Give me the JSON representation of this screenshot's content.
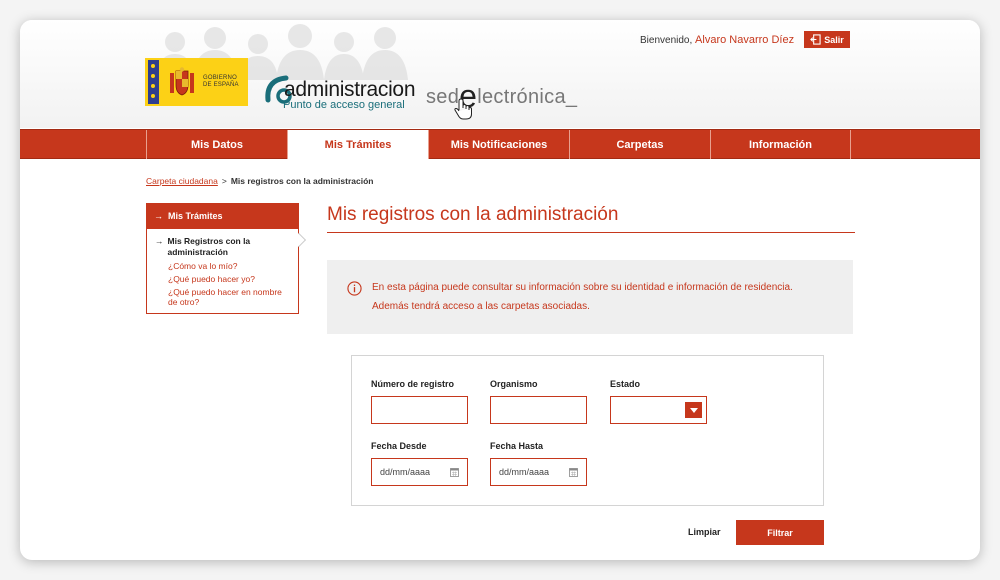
{
  "header": {
    "welcome_prefix": "Bienvenido,",
    "user_name": "Alvaro Navarro Díez",
    "logout_label": "Salir",
    "gobierno_text_1": "GOBIERNO",
    "gobierno_text_2": "DE ESPAÑA",
    "admin_logo_word": "administracion",
    "admin_logo_sub": "Punto de acceso general",
    "sede_logo_prefix": "sed",
    "sede_logo_e": "e",
    "sede_logo_suffix": "lectrónica_"
  },
  "nav": {
    "items": [
      {
        "label": "Mis Datos"
      },
      {
        "label": "Mis Trámites"
      },
      {
        "label": "Mis Notificaciones"
      },
      {
        "label": "Carpetas"
      },
      {
        "label": "Información"
      }
    ],
    "active_index": 1
  },
  "breadcrumb": {
    "link": "Carpeta ciudadana",
    "separator": ">",
    "current": "Mis registros con la administración"
  },
  "sidebar": {
    "header": "Mis Trámites",
    "current": "Mis Registros con la administración",
    "links": [
      "¿Cómo va lo mío?",
      "¿Qué puedo hacer yo?",
      "¿Qué puedo hacer en nombre de otro?"
    ]
  },
  "main": {
    "title": "Mis registros con la administración",
    "info_line1": "En esta página puede consultar su información sobre su identidad e información de residencia.",
    "info_line2": "Además tendrá acceso a las carpetas asociadas."
  },
  "form": {
    "registro_label": "Número de registro",
    "registro_value": "",
    "organismo_label": "Organismo",
    "organismo_value": "",
    "estado_label": "Estado",
    "estado_value": "",
    "desde_label": "Fecha Desde",
    "desde_placeholder": "dd/mm/aaaa",
    "hasta_label": "Fecha Hasta",
    "hasta_placeholder": "dd/mm/aaaa",
    "clear_label": "Limpiar",
    "filter_label": "Filtrar"
  },
  "colors": {
    "accent": "#c6371c",
    "info_bg": "#efefef"
  },
  "icons": {
    "logout": "logout-icon",
    "info": "info-icon",
    "calendar": "calendar-icon",
    "arrow": "arrow-right-icon",
    "dropdown": "chevron-down-icon"
  }
}
